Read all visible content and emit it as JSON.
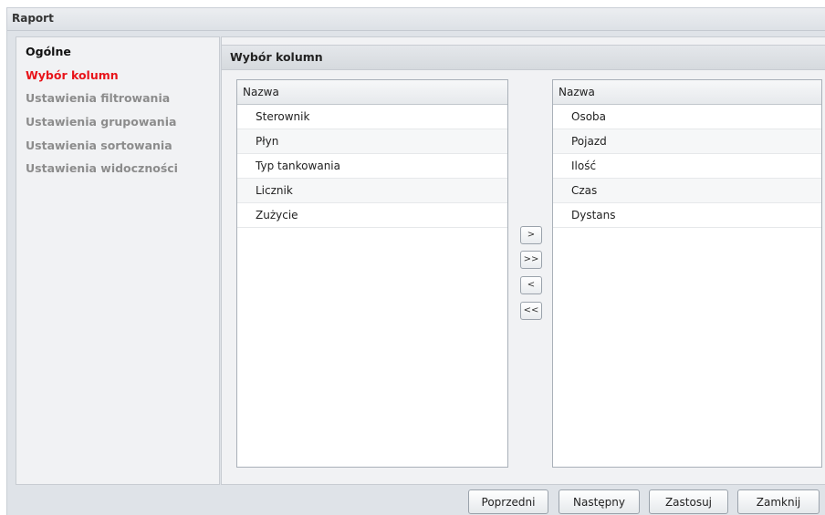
{
  "window": {
    "title": "Raport"
  },
  "nav": {
    "items": [
      {
        "label": "Ogólne",
        "state": "done"
      },
      {
        "label": "Wybór kolumn",
        "state": "active"
      },
      {
        "label": "Ustawienia filtrowania",
        "state": "pending"
      },
      {
        "label": "Ustawienia grupowania",
        "state": "pending"
      },
      {
        "label": "Ustawienia sortowania",
        "state": "pending"
      },
      {
        "label": "Ustawienia widoczności",
        "state": "pending"
      }
    ]
  },
  "section": {
    "title": "Wybór kolumn"
  },
  "available_columns": {
    "header": "Nazwa",
    "rows": [
      "Sterownik",
      "Płyn",
      "Typ tankowania",
      "Licznik",
      "Zużycie"
    ]
  },
  "selected_columns": {
    "header": "Nazwa",
    "rows": [
      "Osoba",
      "Pojazd",
      "Ilość",
      "Czas",
      "Dystans"
    ]
  },
  "movers": {
    "add": ">",
    "add_all": ">>",
    "remove": "<",
    "remove_all": "<<"
  },
  "footer": {
    "previous": "Poprzedni",
    "next": "Następny",
    "apply": "Zastosuj",
    "close": "Zamknij"
  },
  "colors": {
    "active_nav": "#e8141a",
    "inactive_nav": "#8c8c8c",
    "background": "#dfe3e8"
  }
}
